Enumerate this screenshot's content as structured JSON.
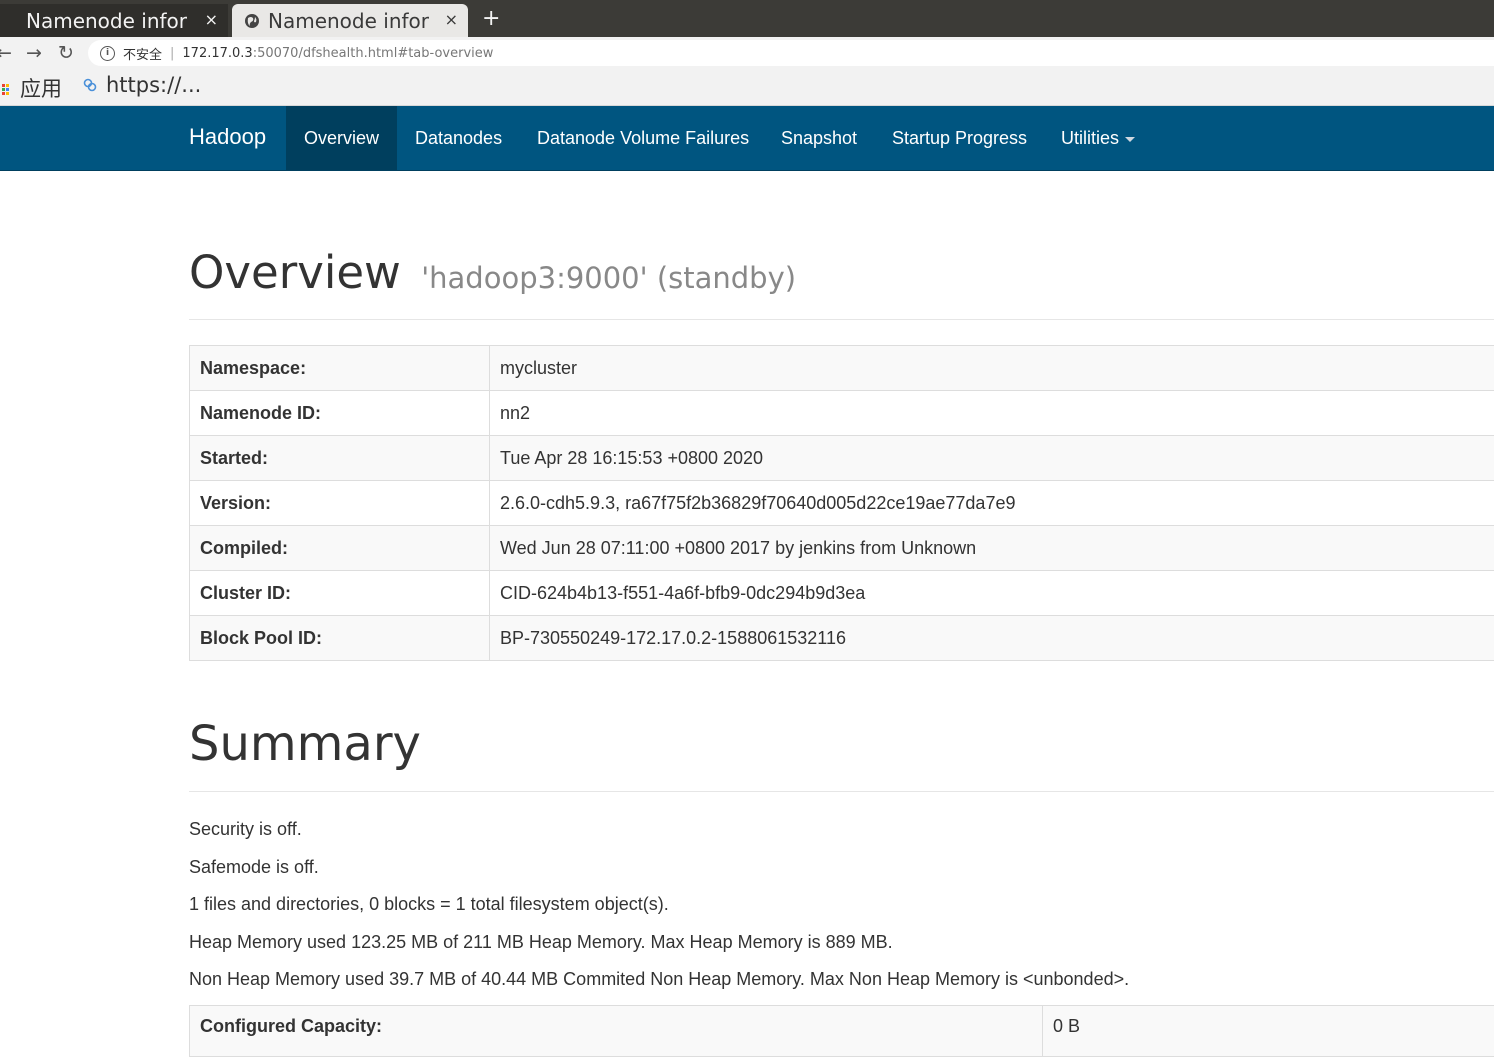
{
  "browser": {
    "tabs": [
      {
        "title": "Namenode infor",
        "close": "×"
      },
      {
        "title": "Namenode infor",
        "close": "×"
      }
    ],
    "new_tab": "+",
    "back": "←",
    "forward": "→",
    "reload": "↻",
    "info_glyph": "i",
    "security_label": "不安全",
    "separator": "|",
    "url_host": "172.17.0.3",
    "url_rest": ":50070/dfshealth.html#tab-overview",
    "bookmarks": [
      {
        "label": "应用"
      },
      {
        "label": "https://..."
      }
    ]
  },
  "navbar": {
    "brand": "Hadoop",
    "items": [
      {
        "label": "Overview",
        "active": true
      },
      {
        "label": "Datanodes"
      },
      {
        "label": "Datanode Volume Failures"
      },
      {
        "label": "Snapshot"
      },
      {
        "label": "Startup Progress"
      },
      {
        "label": "Utilities"
      }
    ]
  },
  "overview": {
    "title": "Overview",
    "subtitle": "'hadoop3:9000' (standby)",
    "rows": [
      {
        "key": "Namespace:",
        "value": "mycluster"
      },
      {
        "key": "Namenode ID:",
        "value": "nn2"
      },
      {
        "key": "Started:",
        "value": "Tue Apr 28 16:15:53 +0800 2020"
      },
      {
        "key": "Version:",
        "value": "2.6.0-cdh5.9.3, ra67f75f2b36829f70640d005d22ce19ae77da7e9"
      },
      {
        "key": "Compiled:",
        "value": "Wed Jun 28 07:11:00 +0800 2017 by jenkins from Unknown"
      },
      {
        "key": "Cluster ID:",
        "value": "CID-624b4b13-f551-4a6f-bfb9-0dc294b9d3ea"
      },
      {
        "key": "Block Pool ID:",
        "value": "BP-730550249-172.17.0.2-1588061532116"
      }
    ]
  },
  "summary": {
    "title": "Summary",
    "lines": [
      "Security is off.",
      "Safemode is off.",
      "1 files and directories, 0 blocks = 1 total filesystem object(s).",
      "Heap Memory used 123.25 MB of 211 MB Heap Memory. Max Heap Memory is 889 MB.",
      "Non Heap Memory used 39.7 MB of 40.44 MB Commited Non Heap Memory. Max Non Heap Memory is <unbonded>."
    ],
    "capacity_label": "Configured Capacity:",
    "capacity_value": "0 B"
  },
  "colors": {
    "navbar_bg": "#005580",
    "navbar_active_bg": "#003f5e"
  }
}
